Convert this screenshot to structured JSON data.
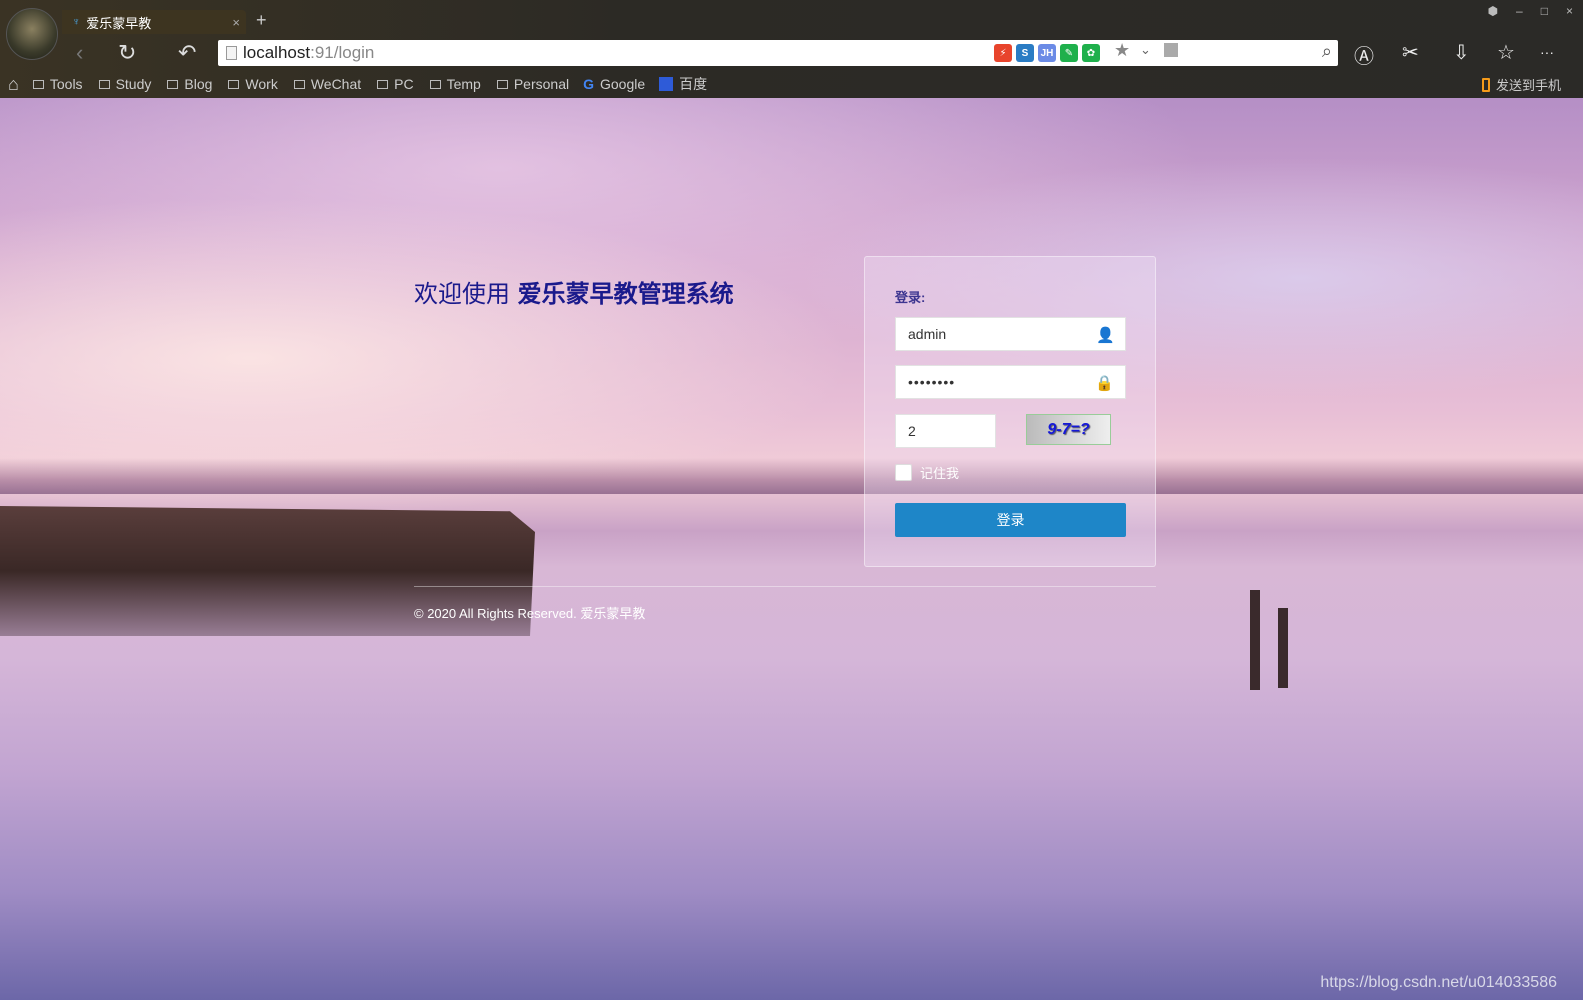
{
  "browser": {
    "tab": {
      "title": "爱乐蒙早教",
      "close": "×"
    },
    "new_tab": "+",
    "window_buttons": [
      "⬢",
      "–",
      "□",
      "×"
    ],
    "url": {
      "host": "localhost",
      "path": ":91/login"
    },
    "extensions": [
      {
        "label": "⚡",
        "color": "#e8442c"
      },
      {
        "label": "S",
        "color": "#2a7cc4"
      },
      {
        "label": "JH",
        "color": "#6b8be6"
      },
      {
        "label": "✎",
        "color": "#1fb04c"
      },
      {
        "label": "✿",
        "color": "#1fb04c"
      }
    ],
    "bookmarks": [
      "Tools",
      "Study",
      "Blog",
      "Work",
      "WeChat",
      "PC",
      "Temp",
      "Personal"
    ],
    "google": "Google",
    "baidu": "百度",
    "send_to_phone": "发送到手机"
  },
  "page": {
    "welcome_prefix": "欢迎使用",
    "system_name": "爱乐蒙早教管理系统",
    "login": {
      "title": "登录:",
      "username": "admin",
      "password": "••••••••",
      "captcha_value": "2",
      "captcha_image": "9-7=?",
      "remember": "记住我",
      "submit": "登录"
    },
    "copyright": "© 2020 All Rights Reserved. 爱乐蒙早教",
    "watermark": "https://blog.csdn.net/u014033586"
  },
  "colors": {
    "accent": "#1e86c8",
    "title": "#1a1a8c"
  }
}
